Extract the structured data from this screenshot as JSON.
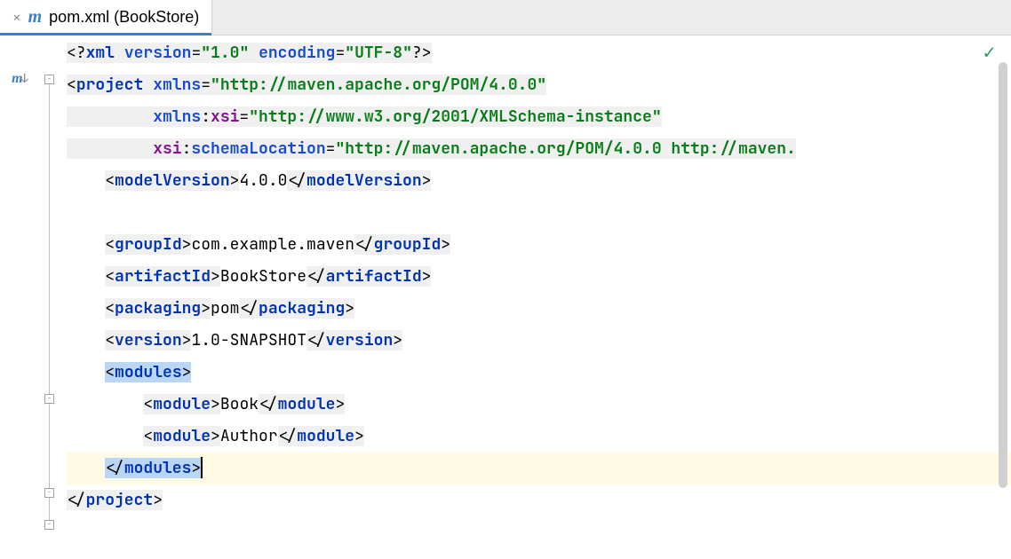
{
  "tab": {
    "filename": "pom.xml (BookStore)",
    "icon_letter": "m"
  },
  "gutter": {
    "m_icon": "m",
    "arrow": "↓"
  },
  "code": {
    "xml_decl_open": "<?",
    "xml_decl_name": "xml",
    "xml_version_attr": "version",
    "xml_version_val": "\"1.0\"",
    "xml_encoding_attr": "encoding",
    "xml_encoding_val": "\"UTF-8\"",
    "xml_decl_close": "?>",
    "project": "project",
    "xmlns_attr": "xmlns",
    "xmlns_val": "\"http://maven.apache.org/POM/4.0.0\"",
    "xmlns_prefix": "xmlns",
    "xsi": "xsi",
    "xsi_val": "\"http://www.w3.org/2001/XMLSchema-instance\"",
    "schemaLocation": "schemaLocation",
    "schemaLocation_val": "\"http://maven.apache.org/POM/4.0.0 http://maven.",
    "modelVersion": "modelVersion",
    "modelVersion_val": "4.0.0",
    "groupId": "groupId",
    "groupId_val": "com.example.maven",
    "artifactId": "artifactId",
    "artifactId_val": "BookStore",
    "packaging": "packaging",
    "packaging_val": "pom",
    "version": "version",
    "version_val": "1.0-SNAPSHOT",
    "modules": "modules",
    "module": "module",
    "module1_val": "Book",
    "module2_val": "Author",
    "lt": "<",
    "gt": ">",
    "ltc": "</",
    "eq": "=",
    "colon": ":",
    "sp": " "
  }
}
